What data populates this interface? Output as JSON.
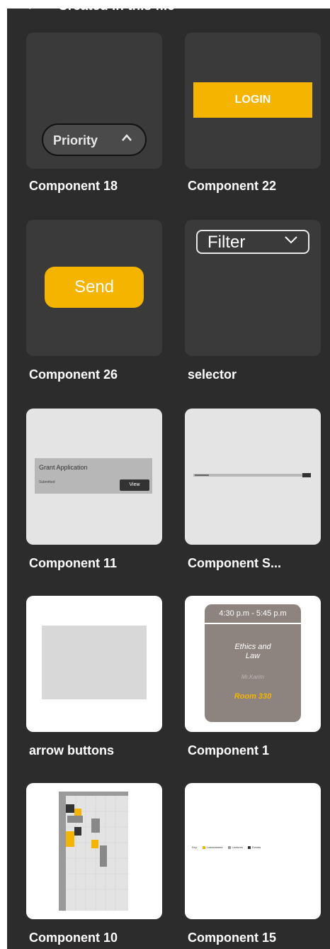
{
  "header": {
    "back_icon": "‹",
    "title": "Created in this file"
  },
  "colors": {
    "accent": "#f5b400",
    "panel": "#2c2c2c",
    "card_dark": "#3a3a3a"
  },
  "components": {
    "c18": {
      "label": "Component 18",
      "pill_text": "Priority"
    },
    "c22": {
      "label": "Component 22",
      "button_text": "LOGIN"
    },
    "c26": {
      "label": "Component 26",
      "button_text": "Send"
    },
    "selector": {
      "label": "selector",
      "filter_text": "Filter"
    },
    "c11": {
      "label": "Component 11",
      "grant_title": "Grant Application",
      "grant_status": "Submitted",
      "view_text": "View"
    },
    "cs": {
      "label": "Component S..."
    },
    "arrow": {
      "label": "arrow buttons"
    },
    "c1": {
      "label": "Component 1",
      "time": "4:30 p.m - 5:45 p.m",
      "course": "Ethics and Law",
      "teacher": "Mr.Karim",
      "room": "Room 330"
    },
    "c10": {
      "label": "Component 10"
    },
    "c15": {
      "label": "Component 15",
      "key_label": "Key:",
      "legend": [
        "Laboratories",
        "Lectures",
        "Events"
      ]
    }
  }
}
